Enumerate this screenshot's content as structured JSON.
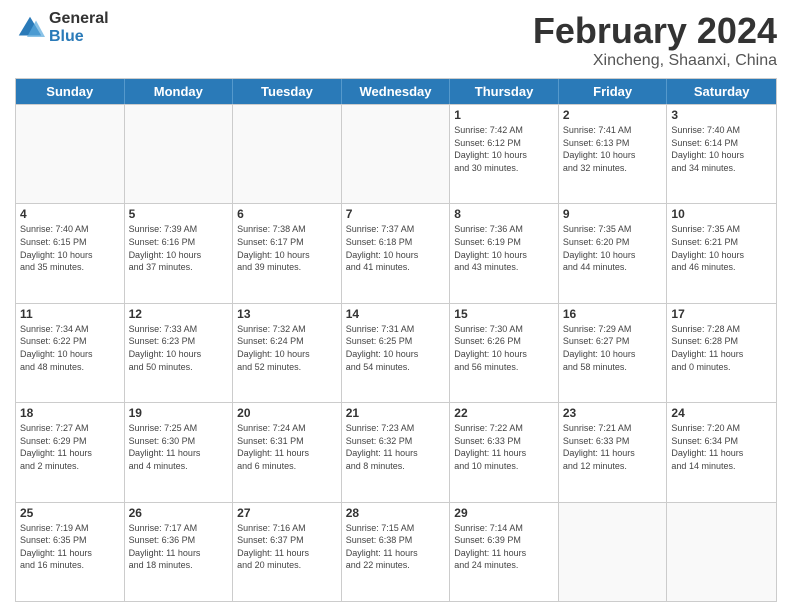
{
  "logo": {
    "general": "General",
    "blue": "Blue"
  },
  "title": {
    "month": "February 2024",
    "location": "Xincheng, Shaanxi, China"
  },
  "header_days": [
    "Sunday",
    "Monday",
    "Tuesday",
    "Wednesday",
    "Thursday",
    "Friday",
    "Saturday"
  ],
  "weeks": [
    [
      {
        "day": "",
        "info": "",
        "empty": true
      },
      {
        "day": "",
        "info": "",
        "empty": true
      },
      {
        "day": "",
        "info": "",
        "empty": true
      },
      {
        "day": "",
        "info": "",
        "empty": true
      },
      {
        "day": "1",
        "info": "Sunrise: 7:42 AM\nSunset: 6:12 PM\nDaylight: 10 hours\nand 30 minutes.",
        "empty": false
      },
      {
        "day": "2",
        "info": "Sunrise: 7:41 AM\nSunset: 6:13 PM\nDaylight: 10 hours\nand 32 minutes.",
        "empty": false
      },
      {
        "day": "3",
        "info": "Sunrise: 7:40 AM\nSunset: 6:14 PM\nDaylight: 10 hours\nand 34 minutes.",
        "empty": false
      }
    ],
    [
      {
        "day": "4",
        "info": "Sunrise: 7:40 AM\nSunset: 6:15 PM\nDaylight: 10 hours\nand 35 minutes.",
        "empty": false
      },
      {
        "day": "5",
        "info": "Sunrise: 7:39 AM\nSunset: 6:16 PM\nDaylight: 10 hours\nand 37 minutes.",
        "empty": false
      },
      {
        "day": "6",
        "info": "Sunrise: 7:38 AM\nSunset: 6:17 PM\nDaylight: 10 hours\nand 39 minutes.",
        "empty": false
      },
      {
        "day": "7",
        "info": "Sunrise: 7:37 AM\nSunset: 6:18 PM\nDaylight: 10 hours\nand 41 minutes.",
        "empty": false
      },
      {
        "day": "8",
        "info": "Sunrise: 7:36 AM\nSunset: 6:19 PM\nDaylight: 10 hours\nand 43 minutes.",
        "empty": false
      },
      {
        "day": "9",
        "info": "Sunrise: 7:35 AM\nSunset: 6:20 PM\nDaylight: 10 hours\nand 44 minutes.",
        "empty": false
      },
      {
        "day": "10",
        "info": "Sunrise: 7:35 AM\nSunset: 6:21 PM\nDaylight: 10 hours\nand 46 minutes.",
        "empty": false
      }
    ],
    [
      {
        "day": "11",
        "info": "Sunrise: 7:34 AM\nSunset: 6:22 PM\nDaylight: 10 hours\nand 48 minutes.",
        "empty": false
      },
      {
        "day": "12",
        "info": "Sunrise: 7:33 AM\nSunset: 6:23 PM\nDaylight: 10 hours\nand 50 minutes.",
        "empty": false
      },
      {
        "day": "13",
        "info": "Sunrise: 7:32 AM\nSunset: 6:24 PM\nDaylight: 10 hours\nand 52 minutes.",
        "empty": false
      },
      {
        "day": "14",
        "info": "Sunrise: 7:31 AM\nSunset: 6:25 PM\nDaylight: 10 hours\nand 54 minutes.",
        "empty": false
      },
      {
        "day": "15",
        "info": "Sunrise: 7:30 AM\nSunset: 6:26 PM\nDaylight: 10 hours\nand 56 minutes.",
        "empty": false
      },
      {
        "day": "16",
        "info": "Sunrise: 7:29 AM\nSunset: 6:27 PM\nDaylight: 10 hours\nand 58 minutes.",
        "empty": false
      },
      {
        "day": "17",
        "info": "Sunrise: 7:28 AM\nSunset: 6:28 PM\nDaylight: 11 hours\nand 0 minutes.",
        "empty": false
      }
    ],
    [
      {
        "day": "18",
        "info": "Sunrise: 7:27 AM\nSunset: 6:29 PM\nDaylight: 11 hours\nand 2 minutes.",
        "empty": false
      },
      {
        "day": "19",
        "info": "Sunrise: 7:25 AM\nSunset: 6:30 PM\nDaylight: 11 hours\nand 4 minutes.",
        "empty": false
      },
      {
        "day": "20",
        "info": "Sunrise: 7:24 AM\nSunset: 6:31 PM\nDaylight: 11 hours\nand 6 minutes.",
        "empty": false
      },
      {
        "day": "21",
        "info": "Sunrise: 7:23 AM\nSunset: 6:32 PM\nDaylight: 11 hours\nand 8 minutes.",
        "empty": false
      },
      {
        "day": "22",
        "info": "Sunrise: 7:22 AM\nSunset: 6:33 PM\nDaylight: 11 hours\nand 10 minutes.",
        "empty": false
      },
      {
        "day": "23",
        "info": "Sunrise: 7:21 AM\nSunset: 6:33 PM\nDaylight: 11 hours\nand 12 minutes.",
        "empty": false
      },
      {
        "day": "24",
        "info": "Sunrise: 7:20 AM\nSunset: 6:34 PM\nDaylight: 11 hours\nand 14 minutes.",
        "empty": false
      }
    ],
    [
      {
        "day": "25",
        "info": "Sunrise: 7:19 AM\nSunset: 6:35 PM\nDaylight: 11 hours\nand 16 minutes.",
        "empty": false
      },
      {
        "day": "26",
        "info": "Sunrise: 7:17 AM\nSunset: 6:36 PM\nDaylight: 11 hours\nand 18 minutes.",
        "empty": false
      },
      {
        "day": "27",
        "info": "Sunrise: 7:16 AM\nSunset: 6:37 PM\nDaylight: 11 hours\nand 20 minutes.",
        "empty": false
      },
      {
        "day": "28",
        "info": "Sunrise: 7:15 AM\nSunset: 6:38 PM\nDaylight: 11 hours\nand 22 minutes.",
        "empty": false
      },
      {
        "day": "29",
        "info": "Sunrise: 7:14 AM\nSunset: 6:39 PM\nDaylight: 11 hours\nand 24 minutes.",
        "empty": false
      },
      {
        "day": "",
        "info": "",
        "empty": true
      },
      {
        "day": "",
        "info": "",
        "empty": true
      }
    ]
  ]
}
